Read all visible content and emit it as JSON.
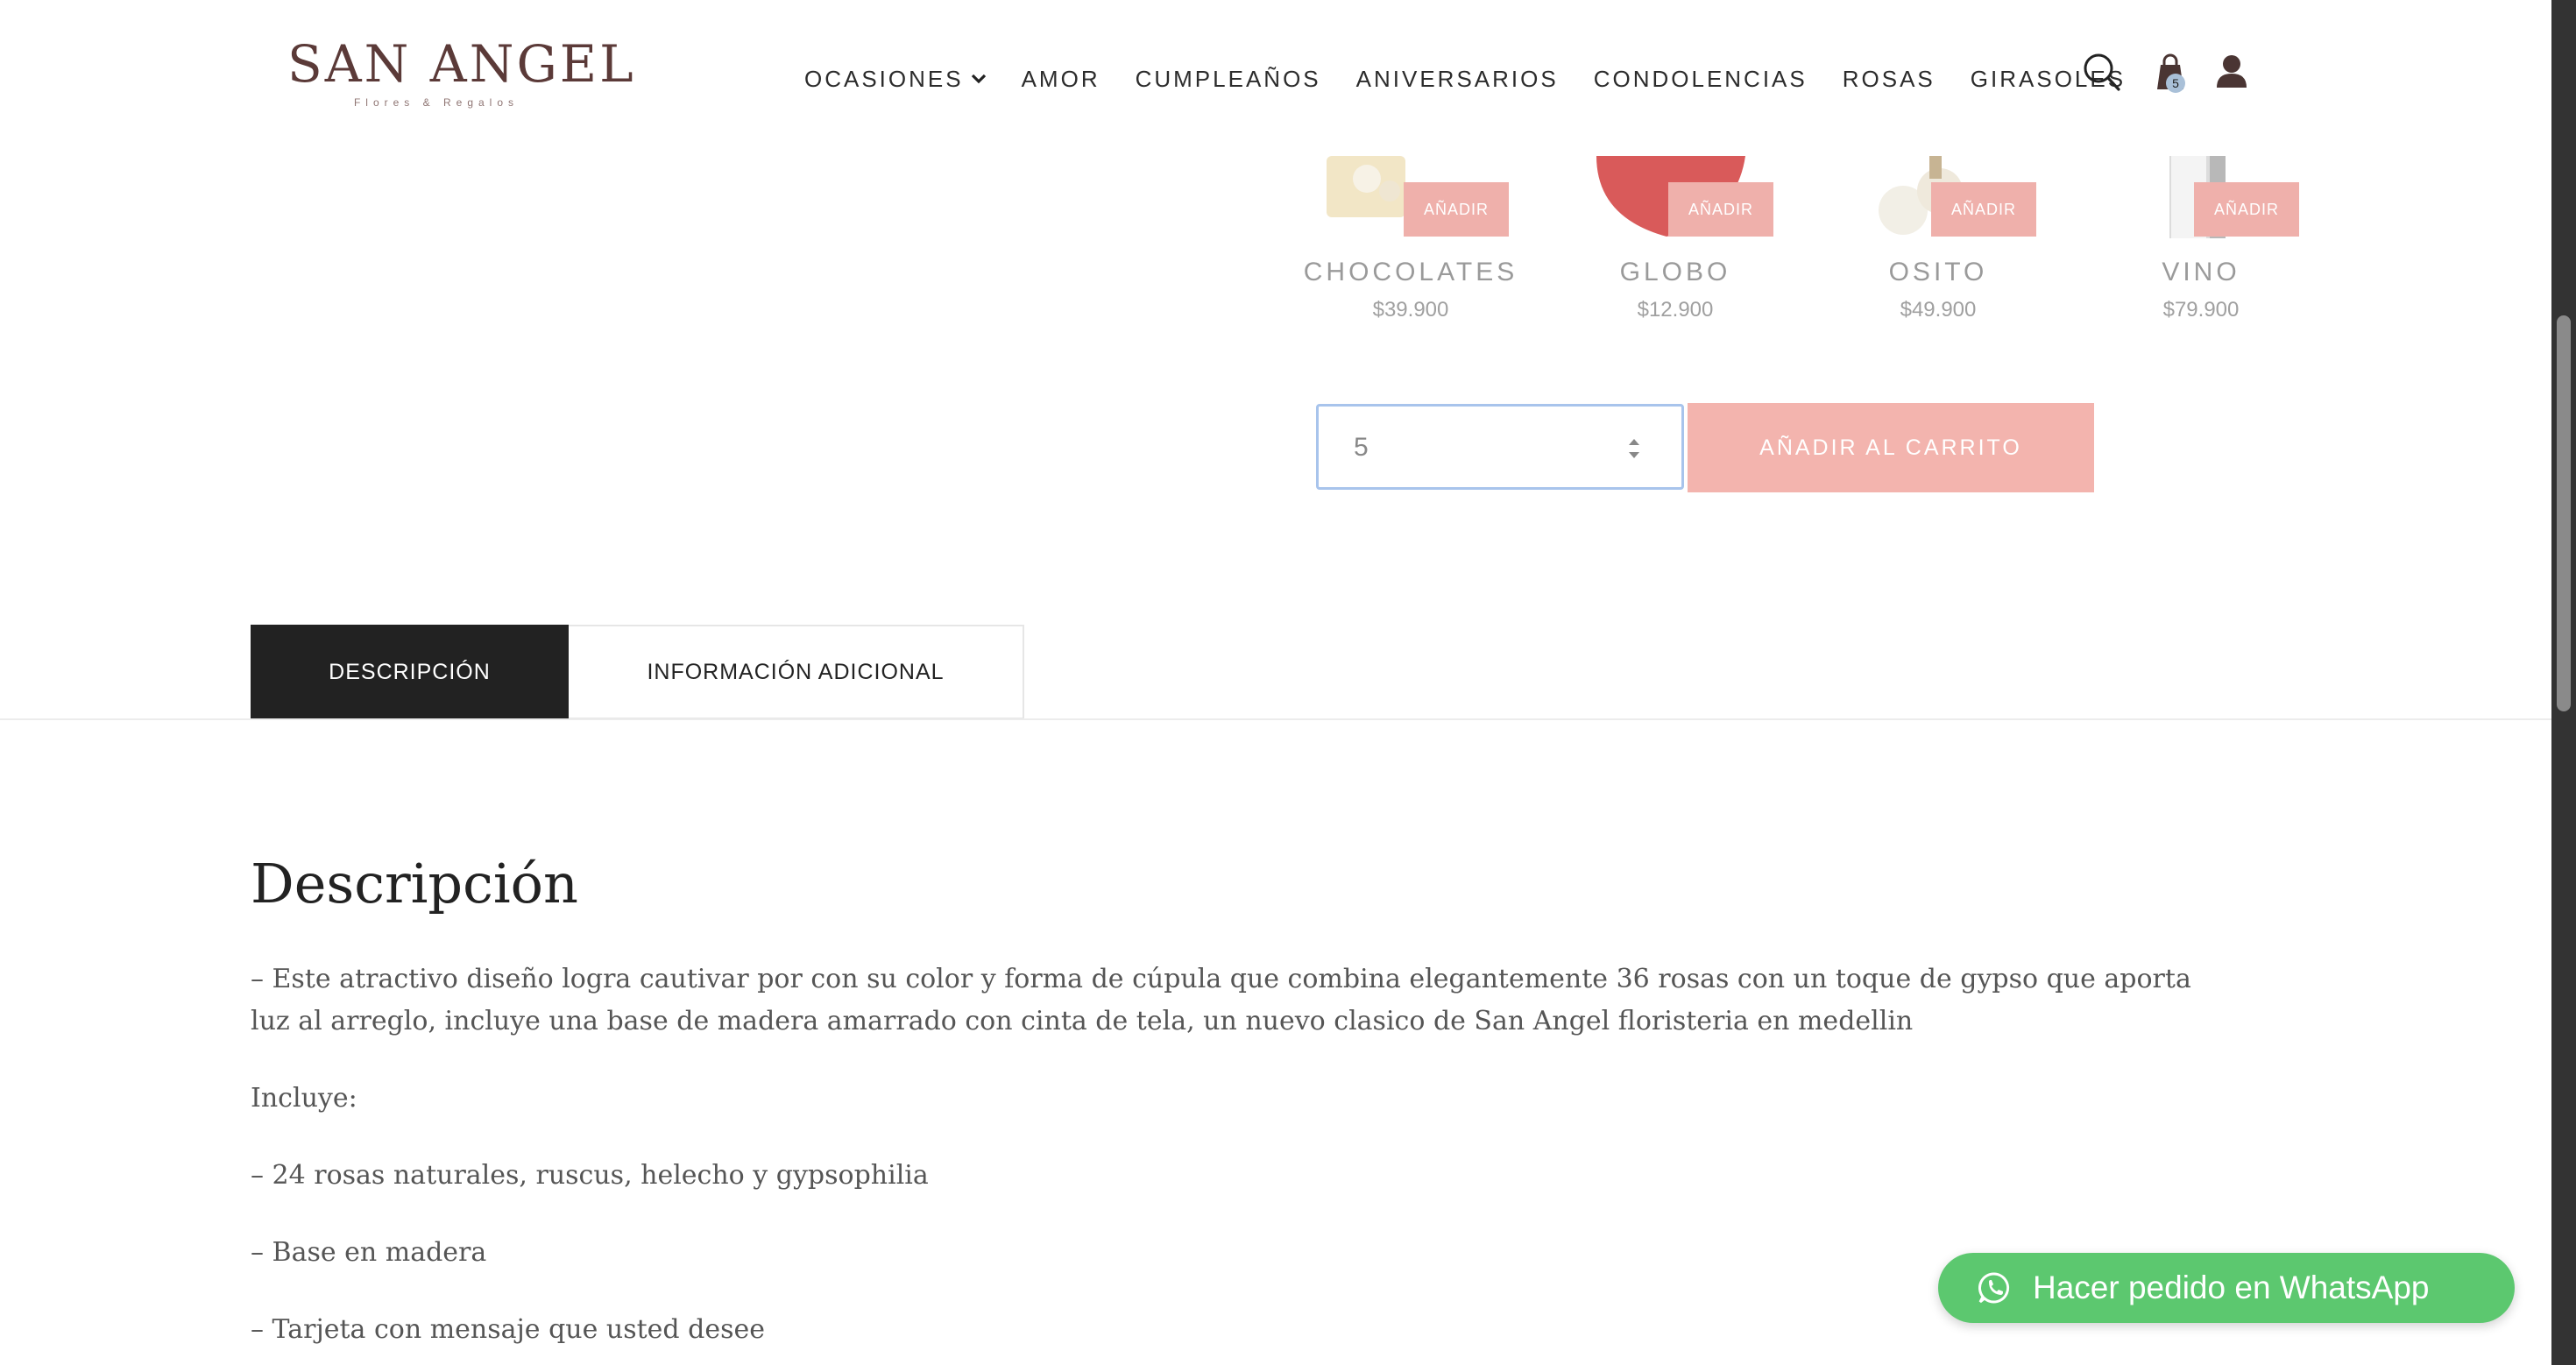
{
  "brand": {
    "name": "SAN ANGEL",
    "tagline": "Flores & Regalos",
    "logo_color": "#5b3a38"
  },
  "nav": {
    "items": [
      {
        "label": "OCASIONES",
        "has_dropdown": true
      },
      {
        "label": "AMOR"
      },
      {
        "label": "CUMPLEAÑOS"
      },
      {
        "label": "ANIVERSARIOS"
      },
      {
        "label": "CONDOLENCIAS"
      },
      {
        "label": "ROSAS"
      },
      {
        "label": "GIRASOLES"
      }
    ],
    "icons": [
      "search-icon",
      "cart-icon",
      "account-icon"
    ],
    "cart_count": "5"
  },
  "addons": [
    {
      "name": "CHOCOLATES",
      "price": "$39.900",
      "button": "AÑADIR"
    },
    {
      "name": "GLOBO",
      "price": "$12.900",
      "button": "AÑADIR"
    },
    {
      "name": "OSITO",
      "price": "$49.900",
      "button": "AÑADIR"
    },
    {
      "name": "VINO",
      "price": "$79.900",
      "button": "AÑADIR"
    }
  ],
  "purchase": {
    "quantity": "5",
    "add_to_cart": "AÑADIR AL CARRITO",
    "accent": "#f3b4ae"
  },
  "tabs": [
    {
      "label": "DESCRIPCIÓN",
      "active": true
    },
    {
      "label": "INFORMACIÓN ADICIONAL",
      "active": false
    }
  ],
  "description": {
    "title": "Descripción",
    "paragraphs": [
      "– Este atractivo diseño logra cautivar por con su color y forma de cúpula que combina elegantemente 36 rosas con un toque de gypso que aporta luz al arreglo, incluye una base de madera amarrado con cinta de tela, un nuevo clasico de San Angel floristeria en medellin",
      "Incluye:",
      "– 24 rosas naturales, ruscus, helecho y gypsophilia",
      "– Base en madera",
      "– Tarjeta con mensaje que usted desee"
    ]
  },
  "whatsapp": {
    "label": "Hacer pedido en WhatsApp",
    "color": "#5cc86f"
  }
}
